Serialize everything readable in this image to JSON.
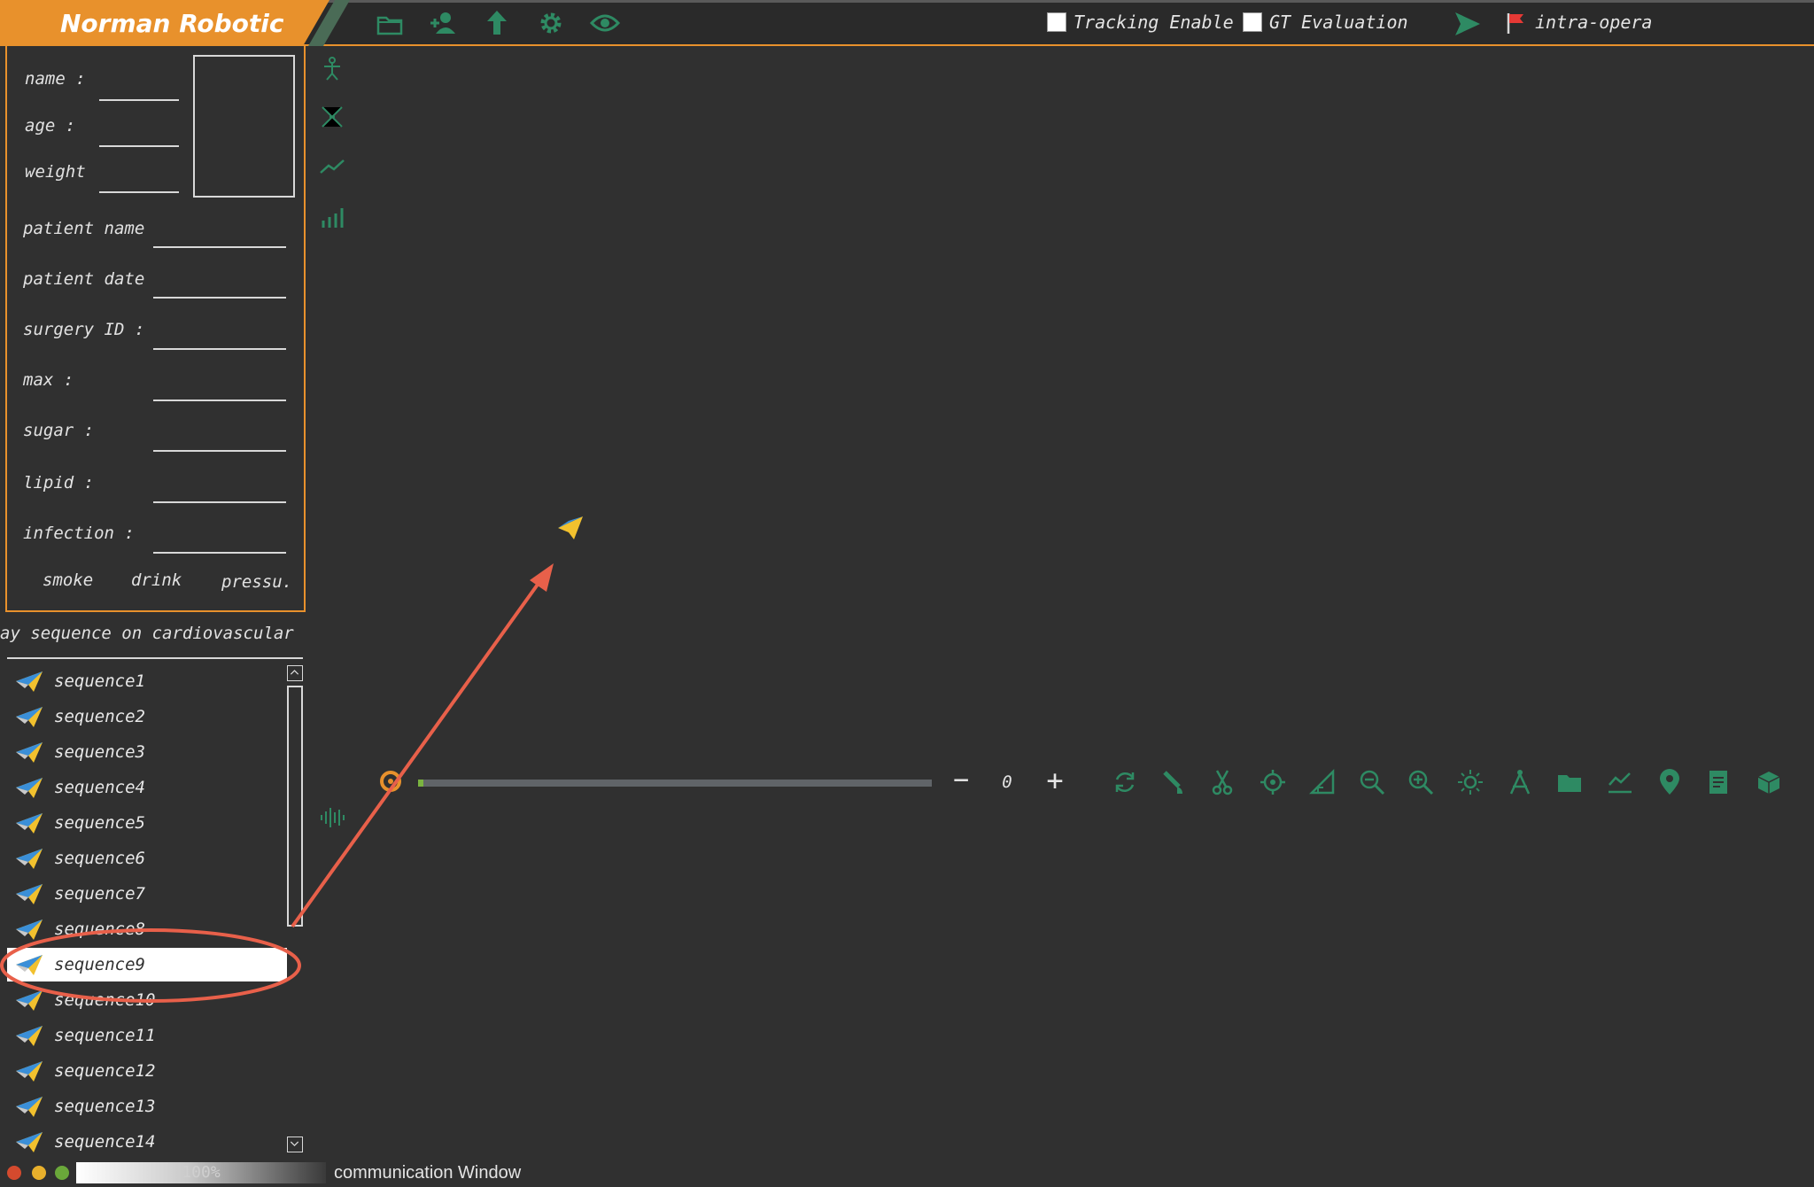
{
  "app": {
    "brand": "Norman Robotic"
  },
  "toolbar": {
    "icons": [
      "open-folder",
      "add-user",
      "upload",
      "settings",
      "view"
    ],
    "tracking_label": "Tracking Enable",
    "tracking_checked": false,
    "gt_label": "GT Evaluation",
    "gt_checked": false,
    "mode_label": "intra-opera"
  },
  "patient_form": {
    "name_label": "name :",
    "age_label": "age :",
    "weight_label": "weight",
    "patient_name_label": "patient name",
    "patient_date_label": "patient date",
    "surgery_id_label": "surgery ID :",
    "max_label": "max :",
    "sugar_label": "sugar :",
    "lipid_label": "lipid :",
    "infection_label": "infection :",
    "smoke_label": "smoke",
    "drink_label": "drink",
    "pressure_label": "pressu."
  },
  "sequence_list": {
    "header": "ay sequence on cardiovascular",
    "items": [
      {
        "label": "sequence1"
      },
      {
        "label": "sequence2"
      },
      {
        "label": "sequence3"
      },
      {
        "label": "sequence4"
      },
      {
        "label": "sequence5"
      },
      {
        "label": "sequence6"
      },
      {
        "label": "sequence7"
      },
      {
        "label": "sequence8"
      },
      {
        "label": "sequence9",
        "selected": true
      },
      {
        "label": "sequence10"
      },
      {
        "label": "sequence11"
      },
      {
        "label": "sequence12"
      },
      {
        "label": "sequence13"
      },
      {
        "label": "sequence14"
      }
    ]
  },
  "timeline": {
    "frame_value": "0",
    "progress_fraction": 0.01,
    "minus_label": "−",
    "plus_label": "+"
  },
  "view_tools": [
    "rotate",
    "brush",
    "cut",
    "target",
    "angle",
    "zoom-out",
    "zoom-in",
    "brightness",
    "measure",
    "folder",
    "chart",
    "pin",
    "report",
    "box"
  ],
  "status": {
    "progress_text": "100%",
    "comm_window": "communication Window"
  },
  "colors": {
    "accent": "#e8912c",
    "icon_green": "#2e8a63",
    "background": "#303030",
    "annotation": "#e8604a"
  }
}
